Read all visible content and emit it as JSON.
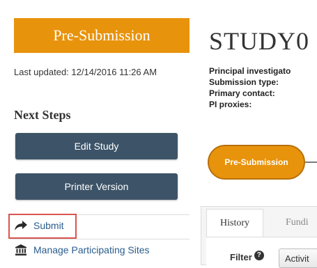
{
  "status": {
    "label": "Pre-Submission",
    "color": "#e8930c"
  },
  "last_updated": "Last updated: 12/14/2016 11:26 AM",
  "next_steps": {
    "heading": "Next Steps",
    "buttons": [
      "Edit Study",
      "Printer Version"
    ],
    "links": [
      {
        "label": "Submit",
        "icon": "share-arrow-icon",
        "highlighted": true
      },
      {
        "label": "Manage Participating Sites",
        "icon": "institution-icon"
      }
    ]
  },
  "study": {
    "title": "STUDY0",
    "fields": [
      "Principal investigato",
      "Submission type:",
      "Primary contact:",
      "PI proxies:"
    ]
  },
  "workflow": {
    "current_state": "Pre-Submission"
  },
  "tabs": [
    "History",
    "Fundi"
  ],
  "filter": {
    "label": "Filter",
    "value": "Activit"
  },
  "colors": {
    "button_bg": "#3d5468",
    "link": "#2a5d8c",
    "highlight_border": "#d9534f"
  }
}
